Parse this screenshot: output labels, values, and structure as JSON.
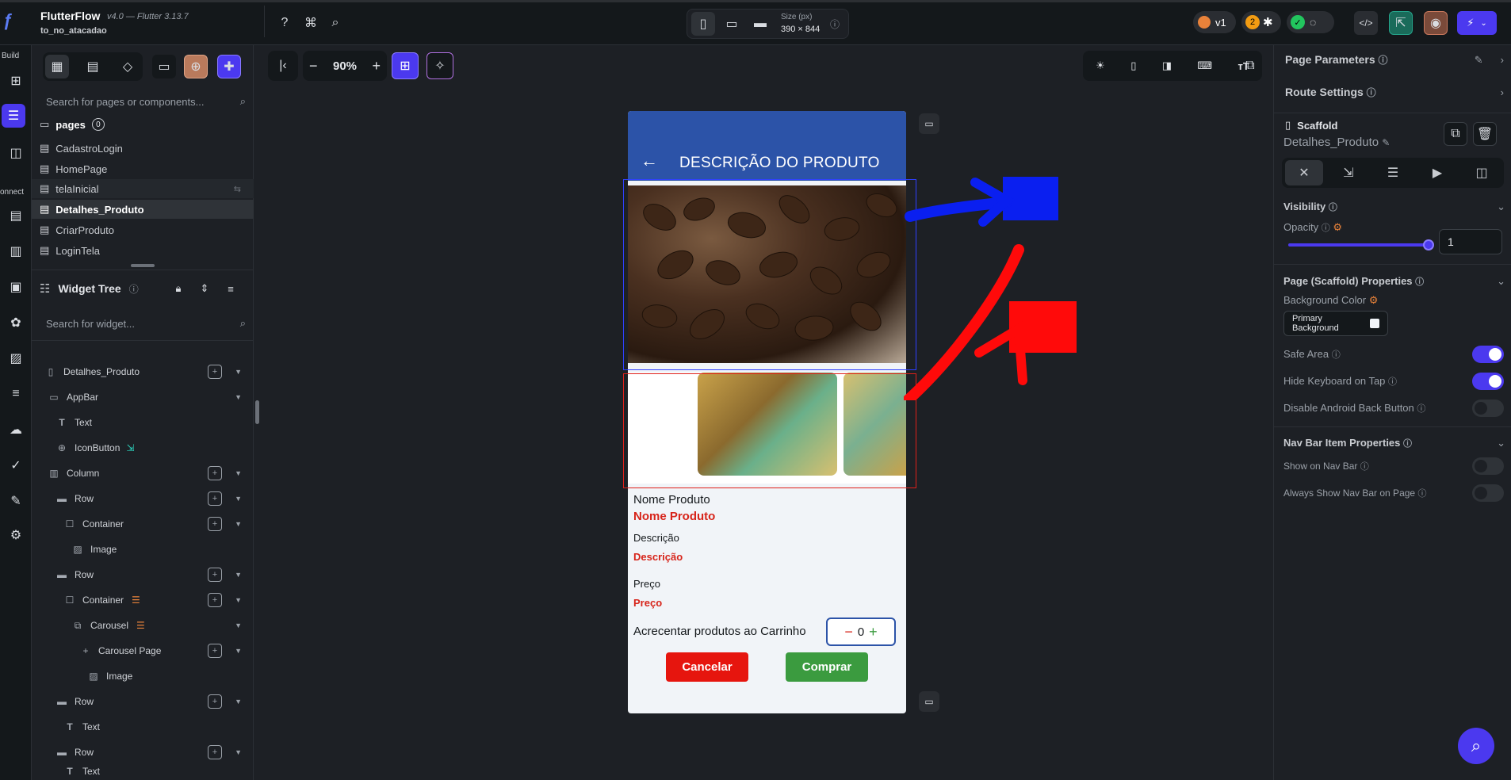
{
  "app": {
    "name": "FlutterFlow",
    "version": "v4.0 — Flutter 3.13.7",
    "project": "to_no_atacadao"
  },
  "toolbar": {
    "size_label": "Size (px)",
    "size_value": "390 × 844",
    "version_badge": "v1",
    "issues_count": "2",
    "zoom": "90%"
  },
  "rail": {
    "build": "Build",
    "connect": "onnect"
  },
  "pages": {
    "search_placeholder": "Search for pages or components...",
    "folder": "pages",
    "count": "0",
    "items": [
      "CadastroLogin",
      "HomePage",
      "telaInicial",
      "Detalhes_Produto",
      "CriarProduto",
      "LoginTela"
    ]
  },
  "widget_tree": {
    "title": "Widget Tree",
    "search_placeholder": "Search for widget...",
    "nodes": [
      "Detalhes_Produto",
      "AppBar",
      "Text",
      "IconButton",
      "Column",
      "Row",
      "Container",
      "Image",
      "Row",
      "Container",
      "Carousel",
      "Carousel Page",
      "Image",
      "Row",
      "Text",
      "Row",
      "Text"
    ]
  },
  "phone": {
    "appbar_title": "DESCRIÇÃO DO PRODUTO",
    "name_label": "Nome Produto",
    "name_value": "Nome Produto",
    "desc_label": "Descrição",
    "desc_value": "Descrição",
    "price_label": "Preço",
    "price_value": "Preço",
    "cart_label": "Acrecentar produtos ao Carrinho",
    "qty": "0",
    "cancel": "Cancelar",
    "buy": "Comprar"
  },
  "right": {
    "page_params": "Page Parameters",
    "route_settings": "Route Settings",
    "widget_type": "Scaffold",
    "widget_name": "Detalhes_Produto",
    "visibility": "Visibility",
    "opacity": "Opacity",
    "opacity_value": "1",
    "scaffold_props": "Page (Scaffold) Properties",
    "bg_color": "Background Color",
    "bg_value": "Primary Background",
    "safe_area": "Safe Area",
    "hide_keyboard": "Hide Keyboard on Tap",
    "disable_back": "Disable Android Back Button",
    "nav_props": "Nav Bar Item Properties",
    "show_nav": "Show on Nav Bar",
    "always_nav": "Always Show Nav Bar on Page"
  },
  "colors": {
    "accent": "#4b39ef",
    "appbar": "#2c53a8",
    "cancel": "#e6150e",
    "buy": "#3b9b3f",
    "red_text": "#d7241a"
  }
}
